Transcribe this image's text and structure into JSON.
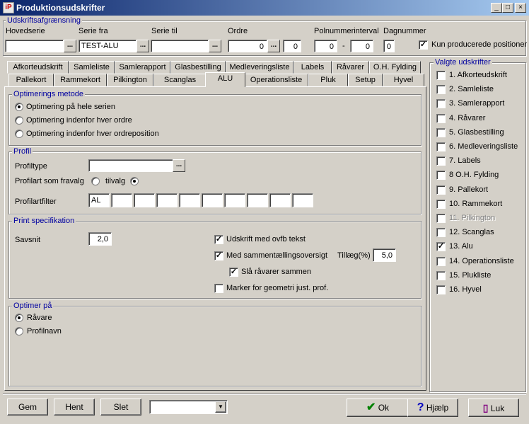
{
  "window": {
    "title": "Produktionsudskrifter",
    "icon": "iP"
  },
  "udskrift": {
    "group": "Udskriftsafgrænsning",
    "hovedserie_label": "Hovedserie",
    "hovedserie_value": "",
    "serie_fra_label": "Serie fra",
    "serie_fra_value": "TEST-ALU",
    "serie_til_label": "Serie til",
    "serie_til_value": "",
    "ordre_label": "Ordre",
    "ordre_value": "0",
    "ordre_pos": "0",
    "pol_label": "Polnummerinterval",
    "pol_from": "0",
    "pol_dash": "-",
    "pol_to": "0",
    "dag_label": "Dagnummer",
    "dag_value": "0",
    "kun_label": "Kun producerede positioner",
    "dots": "..."
  },
  "tabs_row1": [
    "Afkorteudskrift",
    "Samleliste",
    "Samlerapport",
    "Glasbestilling",
    "Medleveringsliste",
    "Labels",
    "Råvarer",
    "O.H. Fylding"
  ],
  "tabs_row2": [
    "Pallekort",
    "Rammekort",
    "Pilkington",
    "Scanglas",
    "ALU",
    "Operationsliste",
    "Pluk",
    "Setup",
    "Hyvel"
  ],
  "opt": {
    "group": "Optimerings metode",
    "items": [
      "Optimering på hele serien",
      "Optimering indenfor hver ordre",
      "Optimering indenfor hver ordreposition"
    ]
  },
  "profil": {
    "group": "Profil",
    "type_label": "Profiltype",
    "fravalg_label": "Profilart som fravalg",
    "tilvalg_label": "tilvalg",
    "filter_label": "Profilartfilter",
    "filter_values": [
      "AL",
      "",
      "",
      "",
      "",
      "",
      "",
      "",
      "",
      ""
    ]
  },
  "print": {
    "group": "Print specifikation",
    "savsnit_label": "Savsnit",
    "savsnit_value": "2,0",
    "c1": "Udskrift med ovfb tekst",
    "c2": "Med sammentællingsoversigt",
    "tillaeg_label": "Tillæg(%)",
    "tillaeg_value": "5,0",
    "c3": "Slå råvarer sammen",
    "c4": "Marker for geometri just. prof."
  },
  "optimer": {
    "group": "Optimer på",
    "items": [
      "Råvare",
      "Profilnavn"
    ]
  },
  "valgte": {
    "group": "Valgte udskrifter",
    "items": [
      {
        "label": "1. Afkorteudskrift",
        "checked": false,
        "disabled": false
      },
      {
        "label": "2. Samleliste",
        "checked": false,
        "disabled": false
      },
      {
        "label": "3. Samlerapport",
        "checked": false,
        "disabled": false
      },
      {
        "label": "4. Råvarer",
        "checked": false,
        "disabled": false
      },
      {
        "label": "5. Glasbestilling",
        "checked": false,
        "disabled": false
      },
      {
        "label": "6. Medleveringsliste",
        "checked": false,
        "disabled": false
      },
      {
        "label": "7. Labels",
        "checked": false,
        "disabled": false
      },
      {
        "label": "8 O.H. Fylding",
        "checked": false,
        "disabled": false
      },
      {
        "label": "9. Pallekort",
        "checked": false,
        "disabled": false
      },
      {
        "label": "10. Rammekort",
        "checked": false,
        "disabled": false
      },
      {
        "label": "11. Pilkington",
        "checked": false,
        "disabled": true
      },
      {
        "label": "12. Scanglas",
        "checked": false,
        "disabled": false
      },
      {
        "label": "13. Alu",
        "checked": true,
        "disabled": false
      },
      {
        "label": "14. Operationsliste",
        "checked": false,
        "disabled": false
      },
      {
        "label": "15. Plukliste",
        "checked": false,
        "disabled": false
      },
      {
        "label": "16. Hyvel",
        "checked": false,
        "disabled": false
      }
    ]
  },
  "bottom": {
    "gem": "Gem",
    "hent": "Hent",
    "slet": "Slet",
    "combo": "",
    "ok": "Ok",
    "hjaelp": "Hjælp",
    "luk": "Luk"
  }
}
